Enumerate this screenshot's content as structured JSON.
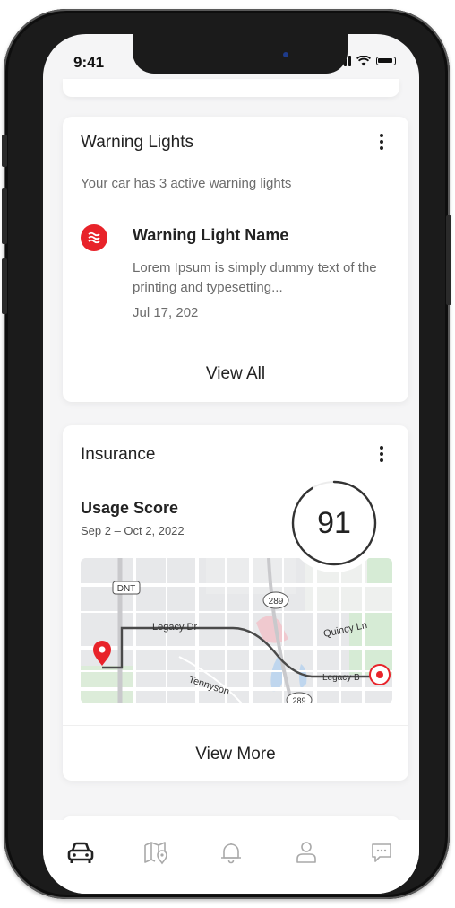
{
  "status_bar": {
    "time": "9:41"
  },
  "warning_card": {
    "title": "Warning Lights",
    "subtitle": "Your car has 3 active warning lights",
    "item": {
      "name": "Warning Light Name",
      "description": "Lorem Ipsum is simply dummy text of the printing and typesetting...",
      "date": "Jul 17, 202"
    },
    "action_label": "View All"
  },
  "insurance_card": {
    "title": "Insurance",
    "usage_label": "Usage Score",
    "usage_range": "Sep 2 – Oct 2, 2022",
    "score": "91",
    "score_fraction": 0.91,
    "map_labels": {
      "dnt": "DNT",
      "route_289_a": "289",
      "route_289_b": "289",
      "legacy_dr": "Legacy Dr",
      "quincy_ln": "Quincy Ln",
      "legacy_b": "Legacy B",
      "tennyson": "Tennyson"
    },
    "action_label": "View More"
  },
  "bottom_nav": {
    "items": [
      {
        "icon": "car-icon",
        "active": true
      },
      {
        "icon": "map-icon",
        "active": false
      },
      {
        "icon": "bell-icon",
        "active": false
      },
      {
        "icon": "profile-icon",
        "active": false
      },
      {
        "icon": "chat-icon",
        "active": false
      }
    ]
  },
  "colors": {
    "accent_red": "#e8232a",
    "text_primary": "#222222",
    "text_secondary": "#6c6c6c",
    "nav_inactive": "#a9a9a9"
  }
}
